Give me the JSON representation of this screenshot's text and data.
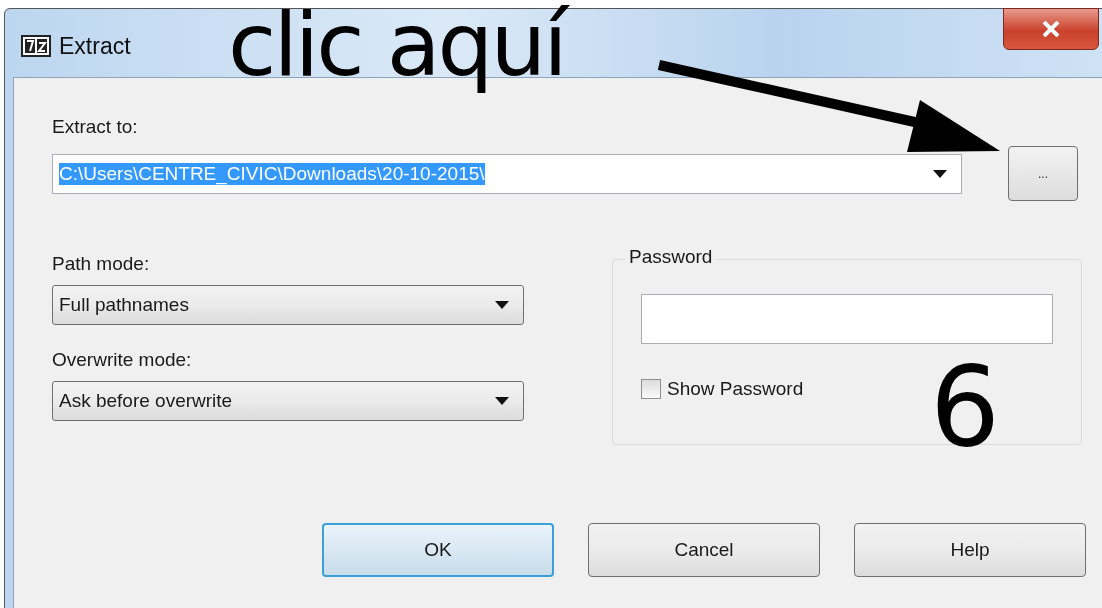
{
  "window": {
    "title": "Extract"
  },
  "extract_to": {
    "label": "Extract to:",
    "value": "C:\\Users\\CENTRE_CIVIC\\Downloads\\20-10-2015\\",
    "selected": true
  },
  "browse_button": {
    "label": "..."
  },
  "path_mode": {
    "label": "Path mode:",
    "value": "Full pathnames"
  },
  "overwrite_mode": {
    "label": "Overwrite mode:",
    "value": "Ask before overwrite"
  },
  "password": {
    "title": "Password",
    "show_password": {
      "label": "Show Password",
      "checked": false
    }
  },
  "buttons": [
    {
      "label": "OK",
      "default": true
    },
    {
      "label": "Cancel",
      "default": false
    },
    {
      "label": "Help",
      "default": false
    }
  ],
  "annotations": [
    {
      "kind": "caption",
      "text": "clic aquí"
    },
    {
      "kind": "number",
      "text": "6"
    }
  ]
}
